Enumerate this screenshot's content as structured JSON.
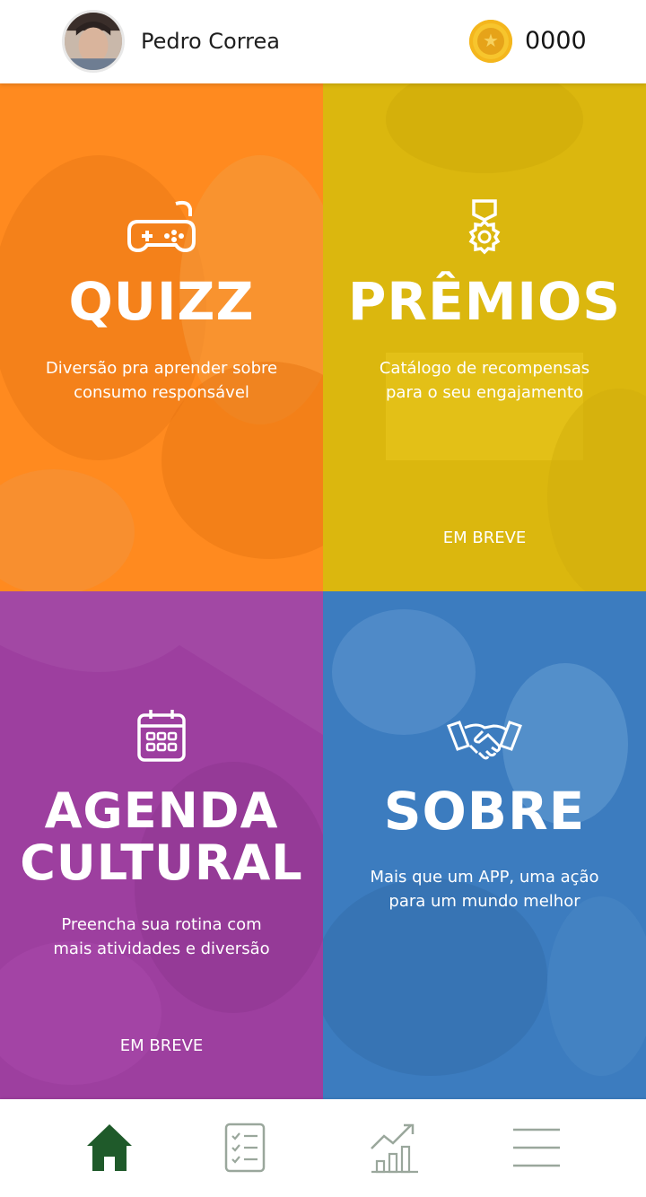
{
  "header": {
    "user_name": "Pedro Correa",
    "coin_count": "0000",
    "coin_icon": "star-coin-icon"
  },
  "tiles": [
    {
      "id": "quizz",
      "icon": "gamepad-icon",
      "title": "QUIZZ",
      "desc_lines": [
        "Diversão pra aprender sobre",
        "consumo responsável"
      ],
      "soon": "",
      "color": "#ff8a1f"
    },
    {
      "id": "premios",
      "icon": "medal-icon",
      "title": "PRÊMIOS",
      "desc_lines": [
        "Catálogo de recompensas",
        "para o seu engajamento"
      ],
      "soon": "EM BREVE",
      "color": "#dbb70e"
    },
    {
      "id": "agenda",
      "icon": "calendar-icon",
      "title_lines": [
        "AGENDA",
        "CULTURAL"
      ],
      "desc_lines": [
        "Preencha sua rotina com",
        "mais atividades e diversão"
      ],
      "soon": "EM BREVE",
      "color": "#9d3f9f"
    },
    {
      "id": "sobre",
      "icon": "handshake-icon",
      "title": "SOBRE",
      "desc_lines": [
        "Mais que um APP, uma ação",
        "para um mundo melhor"
      ],
      "soon": "",
      "color": "#3c7cbf"
    }
  ],
  "bottom_nav": {
    "items": [
      {
        "icon": "home-icon",
        "active": true
      },
      {
        "icon": "checklist-icon",
        "active": false
      },
      {
        "icon": "growth-chart-icon",
        "active": false
      },
      {
        "icon": "menu-icon",
        "active": false
      }
    ],
    "active_color": "#1f5a2a",
    "inactive_color": "#9aa79c"
  }
}
